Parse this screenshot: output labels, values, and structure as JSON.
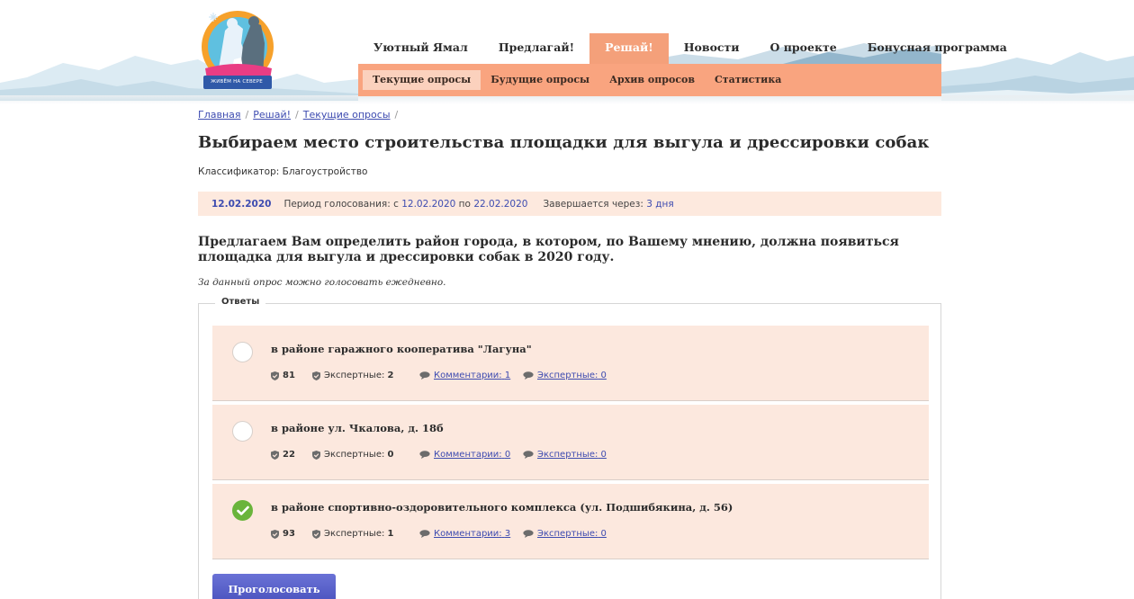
{
  "logo": {
    "text": "ЖИВЁМ НА СЕВЕРЕ"
  },
  "nav": {
    "items": [
      {
        "label": "Уютный Ямал"
      },
      {
        "label": "Предлагай!"
      },
      {
        "label": "Решай!",
        "active": true
      },
      {
        "label": "Новости"
      },
      {
        "label": "О проекте"
      },
      {
        "label": "Бонусная программа"
      }
    ],
    "sub_items": [
      {
        "label": "Текущие опросы",
        "active": true
      },
      {
        "label": "Будущие опросы"
      },
      {
        "label": "Архив опросов"
      },
      {
        "label": "Статистика"
      }
    ]
  },
  "breadcrumb": {
    "items": [
      "Главная",
      "Решай!",
      "Текущие опросы"
    ],
    "separator": "/"
  },
  "poll": {
    "title": "Выбираем место строительства площадки для выгула и дрессировки собак",
    "classifier": "Классификатор: Благоустройство",
    "date": "12.02.2020",
    "period_label": "Период голосования: с",
    "period_from": "12.02.2020",
    "period_to_label": "по",
    "period_to": "22.02.2020",
    "ends_label": "Завершается через:",
    "ends_value": "3 дня",
    "question": "Предлагаем Вам определить район города, в котором, по Вашему мнению, должна появиться площадка для выгула и дрессировки собак в 2020 году.",
    "note": "За данный опрос можно голосовать ежедневно.",
    "answers_legend": "Ответы",
    "expert_label": "Экспертные:",
    "comments_label": "Комментарии:",
    "expert_comments_label": "Экспертные:",
    "options": [
      {
        "title": "в районе гаражного кооператива \"Лагуна\"",
        "votes": "81",
        "expert_votes": "2",
        "comments": "1",
        "expert_comments": "0",
        "selected": false
      },
      {
        "title": "в районе ул. Чкалова, д. 18б",
        "votes": "22",
        "expert_votes": "0",
        "comments": "0",
        "expert_comments": "0",
        "selected": false
      },
      {
        "title": "в районе спортивно-оздоровительного комплекса (ул. Подшибякина, д. 56)",
        "votes": "93",
        "expert_votes": "1",
        "comments": "3",
        "expert_comments": "0",
        "selected": true
      }
    ],
    "vote_button": "Проголосовать"
  },
  "colors": {
    "accent": "#f4a07a",
    "subnav": "#f9a47f",
    "option_bg": "#fce8de",
    "link": "#3d4bb0",
    "button": "#5059c6",
    "check": "#6ab43b"
  }
}
